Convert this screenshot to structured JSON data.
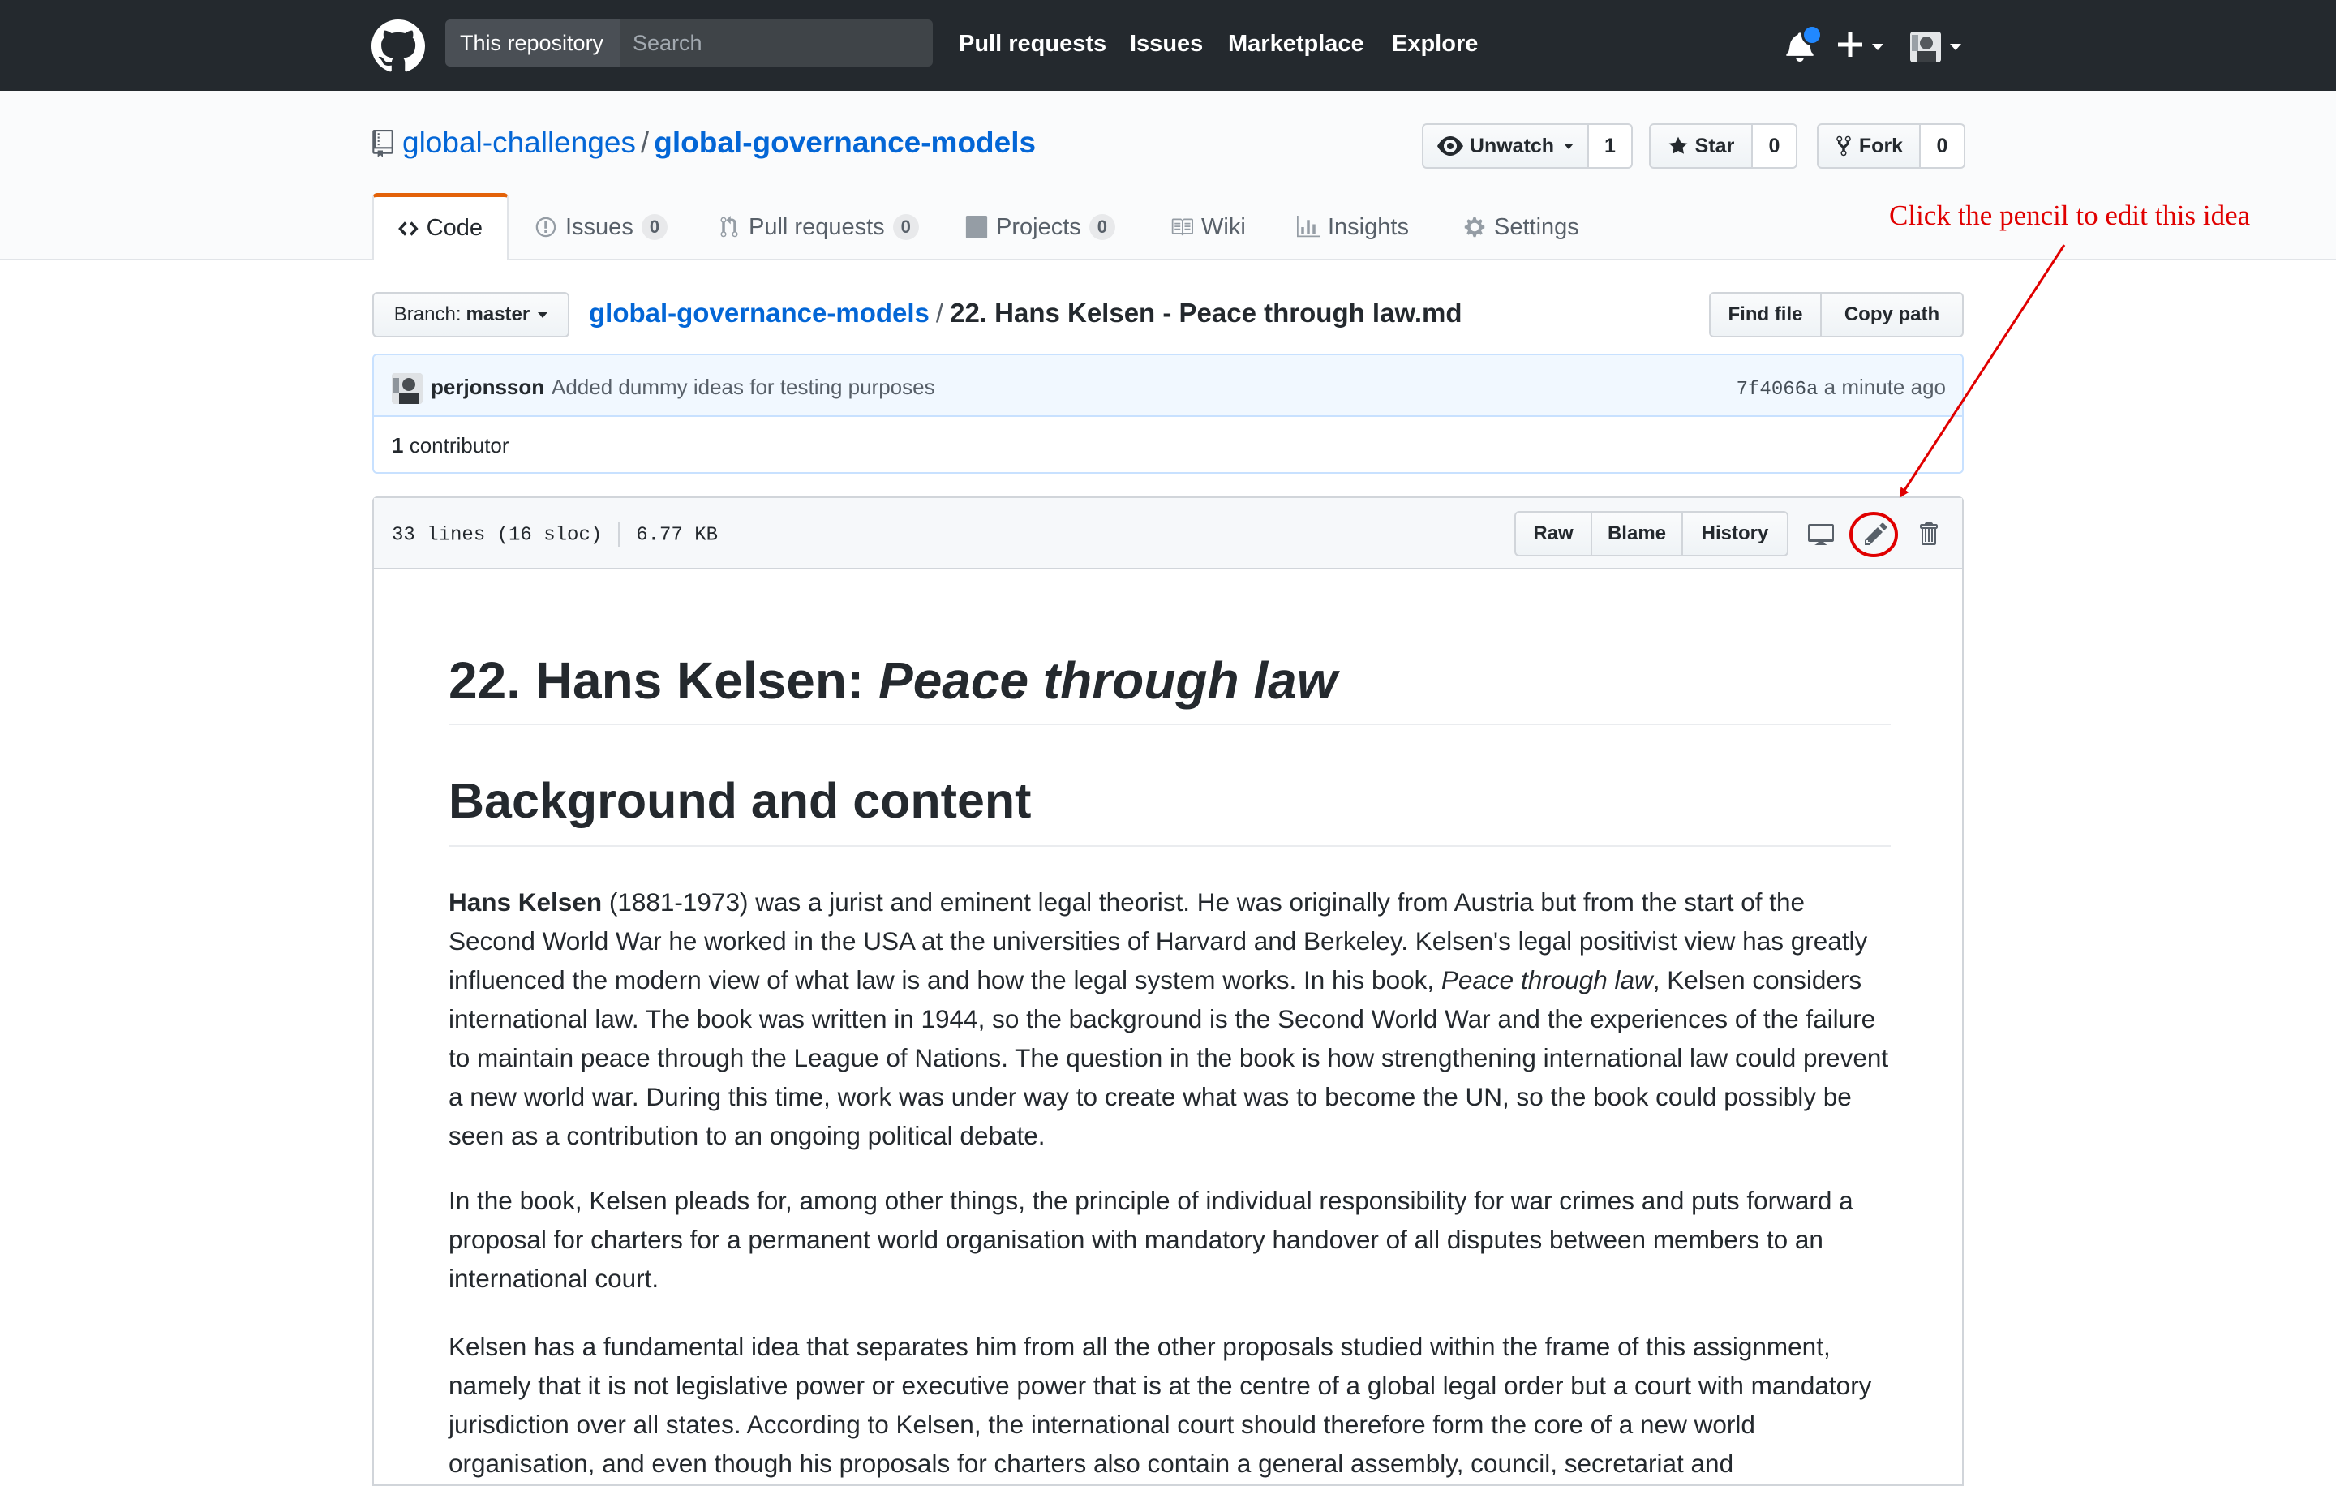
{
  "header": {
    "search_scope": "This repository",
    "search_placeholder": "Search",
    "nav": [
      "Pull requests",
      "Issues",
      "Marketplace",
      "Explore"
    ]
  },
  "repo": {
    "owner": "global-challenges",
    "separator": "/",
    "name": "global-governance-models",
    "watch_label": "Unwatch",
    "watch_count": "1",
    "star_label": "Star",
    "star_count": "0",
    "fork_label": "Fork",
    "fork_count": "0"
  },
  "tabs": {
    "code": "Code",
    "issues": "Issues",
    "issues_count": "0",
    "pulls": "Pull requests",
    "pulls_count": "0",
    "projects": "Projects",
    "projects_count": "0",
    "wiki": "Wiki",
    "insights": "Insights",
    "settings": "Settings"
  },
  "annotation": "Click the pencil to edit this idea",
  "file_nav": {
    "branch_prefix": "Branch:",
    "branch": "master",
    "path_root": "global-governance-models",
    "path_sep": "/",
    "file_name": "22. Hans Kelsen - Peace through law.md",
    "find_file": "Find file",
    "copy_path": "Copy path"
  },
  "commit": {
    "author": "perjonsson",
    "message": "Added dummy ideas for testing purposes",
    "sha": "7f4066a",
    "time": "a minute ago",
    "contributors_count": "1",
    "contributors_label": "contributor"
  },
  "file": {
    "lines": "33 lines (16 sloc)",
    "size": "6.77 KB",
    "raw": "Raw",
    "blame": "Blame",
    "history": "History"
  },
  "readme": {
    "h1_prefix": "22. Hans Kelsen: ",
    "h1_italic": "Peace through law",
    "h2": "Background and content",
    "p1_bold": "Hans Kelsen",
    "p1_a": " (1881-1973) was a jurist and eminent legal theorist. He was originally from Austria but from the start of the Second World War he worked in the USA at the universities of Harvard and Berkeley. Kelsen's legal positivist view has greatly influenced the modern view of what law is and how the legal system works. In his book, ",
    "p1_italic": "Peace through law",
    "p1_b": ", Kelsen considers international law. The book was written in 1944, so the background is the Second World War and the experiences of the failure to maintain peace through the League of Nations. The question in the book is how strengthening international law could prevent a new world war. During this time, work was under way to create what was to become the UN, so the book could possibly be seen as a contribution to an ongoing political debate.",
    "p2": "In the book, Kelsen pleads for, among other things, the principle of individual responsibility for war crimes and puts forward a proposal for charters for a permanent world organisation with mandatory handover of all disputes between members to an international court.",
    "p3": "Kelsen has a fundamental idea that separates him from all the other proposals studied within the frame of this assignment, namely that it is not legislative power or executive power that is at the centre of a global legal order but a court with mandatory jurisdiction over all states. According to Kelsen, the international court should therefore form the core of a new world organisation, and even though his proposals for charters also contain a general assembly, council, secretariat and"
  },
  "colors": {
    "header_bg": "#24292e",
    "link": "#0366d6",
    "tab_accent": "#e36209",
    "annotation": "#e00000",
    "notification_dot": "#2188ff"
  },
  "icons": [
    "github-logo-icon",
    "bell-icon",
    "plus-icon",
    "repo-icon",
    "eye-icon",
    "star-icon",
    "fork-icon",
    "code-icon",
    "issue-icon",
    "pull-request-icon",
    "project-icon",
    "wiki-icon",
    "graph-icon",
    "gear-icon",
    "desktop-icon",
    "pencil-icon",
    "trash-icon"
  ]
}
